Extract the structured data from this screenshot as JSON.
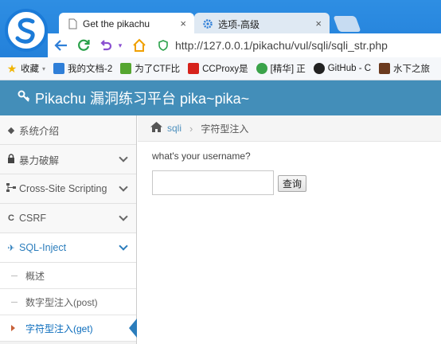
{
  "browser": {
    "tabs": [
      {
        "title": "Get the pikachu",
        "active": true
      },
      {
        "title": "选项-高级",
        "active": false
      }
    ],
    "tab_close": "×",
    "url": "http://127.0.0.1/pikachu/vul/sqli/sqli_str.php",
    "bookmarks": [
      {
        "label": "收藏",
        "icon": "star-icon",
        "color": "#f0b400"
      },
      {
        "label": "我的文档-2",
        "icon": "doc-icon",
        "color": "#2f7fd8"
      },
      {
        "label": "为了CTF比",
        "icon": "flag-icon",
        "color": "#55a630"
      },
      {
        "label": "CCProxy是",
        "icon": "proxy-icon",
        "color": "#d6221c"
      },
      {
        "label": "[精华] 正",
        "icon": "c-icon",
        "color": "#3aa34a"
      },
      {
        "label": "GitHub - C",
        "icon": "github-icon",
        "color": "#222222"
      },
      {
        "label": "水下之旅",
        "icon": "image-icon",
        "color": "#6b3a1e"
      }
    ]
  },
  "app": {
    "title": "Pikachu 漏洞练习平台 pika~pika~",
    "header_color": "#438eb9"
  },
  "sidebar": {
    "items": [
      {
        "label": "系统介绍",
        "icon": "tags-icon",
        "has_chevron": false
      },
      {
        "label": "暴力破解",
        "icon": "lock-icon",
        "has_chevron": true
      },
      {
        "label": "Cross-Site Scripting",
        "icon": "sitemap-icon",
        "has_chevron": true
      },
      {
        "label": "CSRF",
        "icon": "c-icon",
        "has_chevron": true
      },
      {
        "label": "SQL-Inject",
        "icon": "plane-icon",
        "has_chevron": true,
        "open": true
      }
    ],
    "subitems": [
      {
        "label": "概述"
      },
      {
        "label": "数字型注入(post)"
      },
      {
        "label": "字符型注入(get)",
        "active": true
      }
    ]
  },
  "breadcrumb": {
    "link": "sqli",
    "current": "字符型注入"
  },
  "form": {
    "question": "what's your username?",
    "input_value": "",
    "button": "查询"
  }
}
